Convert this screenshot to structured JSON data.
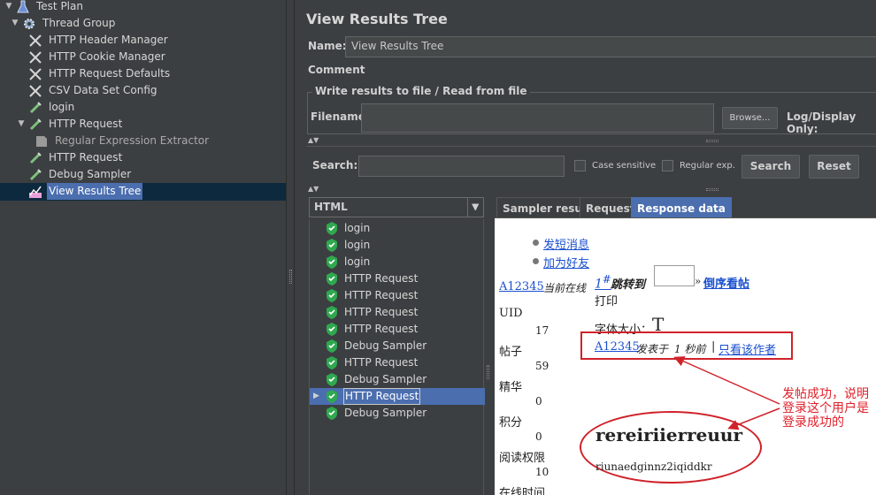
{
  "tree": {
    "items": [
      {
        "label": "Test Plan",
        "icon": "flask-icon",
        "expanded": true
      },
      {
        "label": "Thread Group",
        "icon": "gear-icon",
        "expanded": true
      },
      {
        "label": "HTTP Header Manager",
        "icon": "wrench-icon"
      },
      {
        "label": "HTTP Cookie Manager",
        "icon": "wrench-icon"
      },
      {
        "label": "HTTP Request Defaults",
        "icon": "wrench-icon"
      },
      {
        "label": "CSV Data Set Config",
        "icon": "wrench-icon"
      },
      {
        "label": "login",
        "icon": "pipette-icon"
      },
      {
        "label": "HTTP Request",
        "icon": "pipette-icon",
        "expanded": true
      },
      {
        "label": "Regular Expression Extractor",
        "icon": "extractor-icon"
      },
      {
        "label": "HTTP Request",
        "icon": "pipette-icon"
      },
      {
        "label": "Debug Sampler",
        "icon": "pipette-icon"
      },
      {
        "label": "View Results Tree",
        "icon": "graph-icon",
        "selected": true
      }
    ]
  },
  "panel": {
    "title": "View Results Tree",
    "name_label": "Name:",
    "name_value": "View Results Tree",
    "comments_label": "Comments:",
    "fieldset_legend": "Write results to file / Read from file",
    "filename_label": "Filename",
    "browse_label": "Browse...",
    "log_display_label": "Log/Display Only:",
    "search_label": "Search:",
    "case_sensitive_label": "Case sensitive",
    "regex_label": "Regular exp.",
    "search_button": "Search",
    "reset_button": "Reset"
  },
  "renderer": {
    "selected": "HTML"
  },
  "samples": [
    {
      "label": "login",
      "status": "success"
    },
    {
      "label": "login",
      "status": "success"
    },
    {
      "label": "login",
      "status": "success"
    },
    {
      "label": "HTTP Request",
      "status": "success"
    },
    {
      "label": "HTTP Request",
      "status": "success"
    },
    {
      "label": "HTTP Request",
      "status": "success"
    },
    {
      "label": "HTTP Request",
      "status": "success"
    },
    {
      "label": "Debug Sampler",
      "status": "success"
    },
    {
      "label": "HTTP Request",
      "status": "success"
    },
    {
      "label": "Debug Sampler",
      "status": "success"
    },
    {
      "label": "HTTP Request",
      "status": "success",
      "selected": true
    },
    {
      "label": "Debug Sampler",
      "status": "success"
    }
  ],
  "tabs": [
    {
      "label": "Sampler result"
    },
    {
      "label": "Request"
    },
    {
      "label": "Response data",
      "active": true
    }
  ],
  "response": {
    "send_message": "发短消息",
    "add_friend": "加为好友",
    "user_link": "A12345",
    "online_text": "当前在线",
    "hash": "#",
    "jump_to": "跳转到",
    "guillemet": "»",
    "reverse_view": "倒序看帖",
    "print": "打印",
    "font_size": "字体大小：",
    "font_T": "T",
    "uid_label": "UID",
    "uid_value": "17",
    "posts_label": "帖子",
    "posts_value": "59",
    "elite_label": "精华",
    "elite_value": "0",
    "points_label": "积分",
    "points_value": "0",
    "read_perm_label": "阅读权限",
    "read_perm_value": "10",
    "online_time_label": "在线时间",
    "post_user": "A12345",
    "posted_at": "发表于",
    "posted_time": "1 秒前",
    "separator": "|",
    "only_author": "只看该作者",
    "post_title": "rereiriierreuur",
    "post_body": "riunaedginnz2iqiddkr",
    "annotation": "发帖成功，说明登录这个用户是登录成功的"
  },
  "colors": {
    "accent": "#4b6eaf",
    "annotation": "#d0222a",
    "link": "#1a4fd0",
    "success_shield": "#2fa84f"
  }
}
